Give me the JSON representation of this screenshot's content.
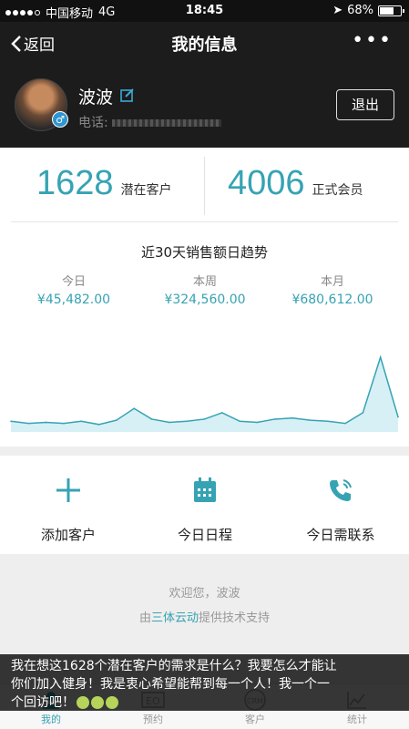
{
  "status": {
    "carrier": "中国移动",
    "network": "4G",
    "time": "18:45",
    "battery": "68%",
    "battery_level": 0.68
  },
  "nav": {
    "back_label": "返回",
    "title": "我的信息",
    "more": "•••"
  },
  "profile": {
    "name": "波波",
    "phone_label": "电话:",
    "logout_label": "退出"
  },
  "stats": [
    {
      "value": "1628",
      "label": "潜在客户"
    },
    {
      "value": "4006",
      "label": "正式会员"
    }
  ],
  "trend": {
    "title": "近30天销售额日趋势",
    "periods": [
      {
        "label": "今日",
        "value": "¥45,482.00"
      },
      {
        "label": "本周",
        "value": "¥324,560.00"
      },
      {
        "label": "本月",
        "value": "¥680,612.00"
      }
    ]
  },
  "chart_data": {
    "type": "area",
    "title": "近30天销售额日趋势",
    "values": [
      10,
      8,
      9,
      8,
      10,
      7,
      11,
      22,
      12,
      9,
      10,
      12,
      18,
      10,
      9,
      12,
      13,
      11,
      10,
      8,
      18,
      70,
      14
    ],
    "color": "#36a3b3",
    "fill": "#d6f0f5"
  },
  "actions": [
    {
      "label": "添加客户",
      "icon": "plus-icon"
    },
    {
      "label": "今日日程",
      "icon": "calendar-icon"
    },
    {
      "label": "今日需联系",
      "icon": "phone-icon"
    }
  ],
  "footer": {
    "welcome": "欢迎您，波波",
    "support_prefix": "由",
    "brand": "三体云动",
    "support_suffix": "提供技术支持"
  },
  "tabs": [
    {
      "label": "我的",
      "icon": "user-icon"
    },
    {
      "label": "预约",
      "icon": "eo-icon"
    },
    {
      "label": "客户",
      "icon": "crm-icon"
    },
    {
      "label": "统计",
      "icon": "stats-icon"
    }
  ],
  "caption": {
    "line1": "我在想这1628个潜在客户的需求是什么？我要怎么才能让",
    "line2": "你们加入健身！我是衷心希望能帮到每一个人！我一个一",
    "line3": "个回访吧！"
  }
}
